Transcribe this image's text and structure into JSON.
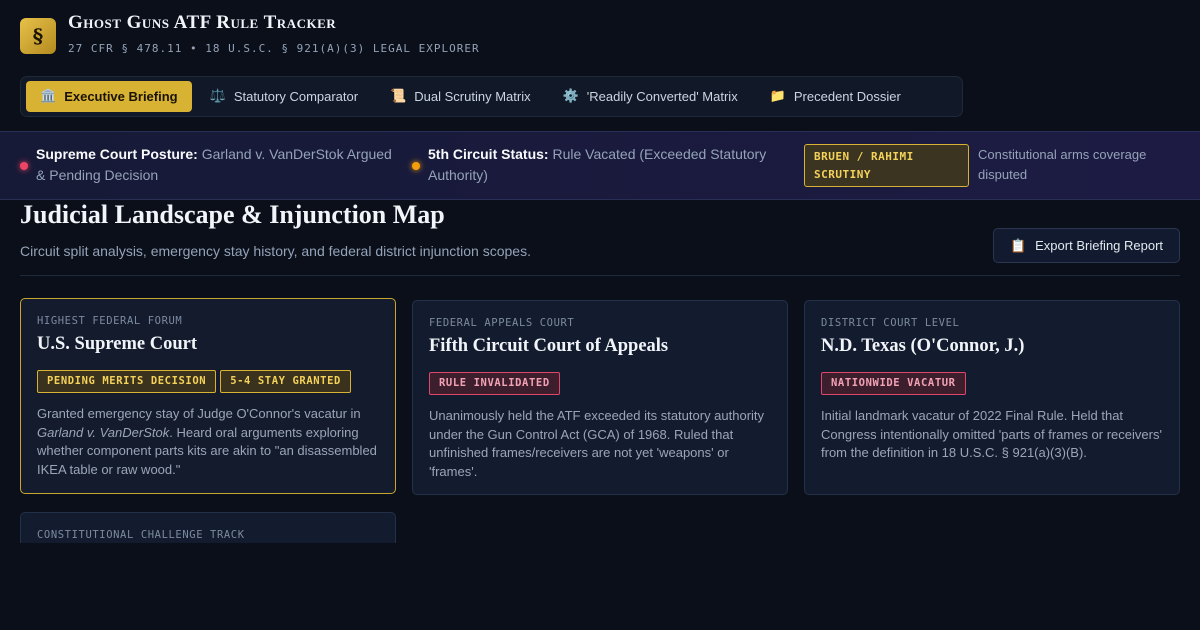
{
  "header": {
    "logo_glyph": "§",
    "title": "Ghost Guns ATF Rule Tracker",
    "subtitle": "27 CFR § 478.11 • 18 U.S.C. § 921(A)(3) LEGAL EXPLORER"
  },
  "tabs": [
    {
      "icon": "🏛️",
      "label": "Executive Briefing",
      "active": true
    },
    {
      "icon": "⚖️",
      "label": "Statutory Comparator"
    },
    {
      "icon": "📜",
      "label": "Dual Scrutiny Matrix"
    },
    {
      "icon": "⚙️",
      "label": "'Readily Converted' Matrix"
    },
    {
      "icon": "📁",
      "label": "Precedent Dossier"
    }
  ],
  "status": {
    "supreme": {
      "key": "Supreme Court Posture:",
      "value": " Garland v. VanDerStok Argued & Pending Decision"
    },
    "fifth": {
      "key": "5th Circuit Status:",
      "value": " Rule Vacated (Exceeded Statutory Authority)"
    },
    "scrutiny_badge": "BRUEN / RAHIMI SCRUTINY",
    "scrutiny_note": "Constitutional arms coverage disputed"
  },
  "section": {
    "title": "Judicial Landscape & Injunction Map",
    "description": "Circuit split analysis, emergency stay history, and federal district injunction scopes.",
    "export_icon": "📋",
    "export_label": "Export Briefing Report"
  },
  "cards": [
    {
      "kicker": "HIGHEST FEDERAL FORUM",
      "title": "U.S. Supreme Court",
      "badges": [
        "PENDING MERITS DECISION",
        "5-4 STAY GRANTED"
      ],
      "body_pre": "Granted emergency stay of Judge O'Connor's vacatur in ",
      "body_case": "Garland v. VanDerStok",
      "body_post": ". Heard oral arguments exploring whether component parts kits are akin to \"an disassembled IKEA table or raw wood.\""
    },
    {
      "kicker": "FEDERAL APPEALS COURT",
      "title": "Fifth Circuit Court of Appeals",
      "badges": [
        "RULE INVALIDATED"
      ],
      "body": "Unanimously held the ATF exceeded its statutory authority under the Gun Control Act (GCA) of 1968. Ruled that unfinished frames/receivers are not yet 'weapons' or 'frames'."
    },
    {
      "kicker": "DISTRICT COURT LEVEL",
      "title": "N.D. Texas (O'Connor, J.)",
      "badges": [
        "NATIONWIDE VACATUR"
      ],
      "body": "Initial landmark vacatur of 2022 Final Rule. Held that Congress intentionally omitted 'parts of frames or receivers' from the definition in 18 U.S.C. § 921(a)(3)(B)."
    },
    {
      "kicker": "CONSTITUTIONAL CHALLENGE TRACK"
    }
  ],
  "colors": {
    "accent_gold": "#d8b232",
    "alert_red": "#ef4565",
    "alert_amber": "#f59e0b"
  }
}
